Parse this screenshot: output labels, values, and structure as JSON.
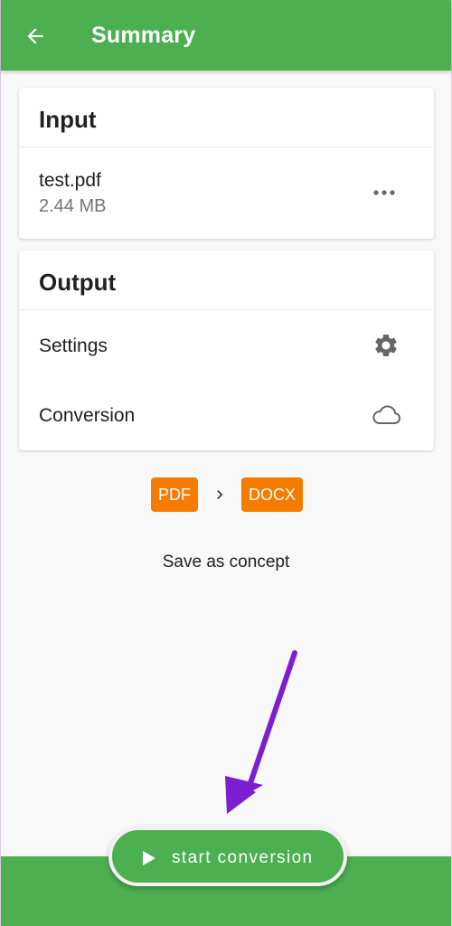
{
  "app_bar": {
    "title": "Summary",
    "back_icon": "arrow-left-icon"
  },
  "input_card": {
    "header": "Input",
    "file": {
      "name": "test.pdf",
      "size": "2.44 MB",
      "menu_icon": "more-horizontal-icon"
    }
  },
  "output_card": {
    "header": "Output",
    "rows": [
      {
        "label": "Settings",
        "icon": "gear-icon"
      },
      {
        "label": "Conversion",
        "icon": "cloud-icon"
      }
    ]
  },
  "formats": {
    "from": "PDF",
    "to": "DOCX",
    "separator_icon": "chevron-right-icon"
  },
  "save_concept": "Save as concept",
  "start_button": {
    "label": "start conversion",
    "icon": "play-icon"
  },
  "colors": {
    "primary": "#4caf50",
    "badge": "#f57c00",
    "annotation_arrow": "#7b1fd1"
  }
}
